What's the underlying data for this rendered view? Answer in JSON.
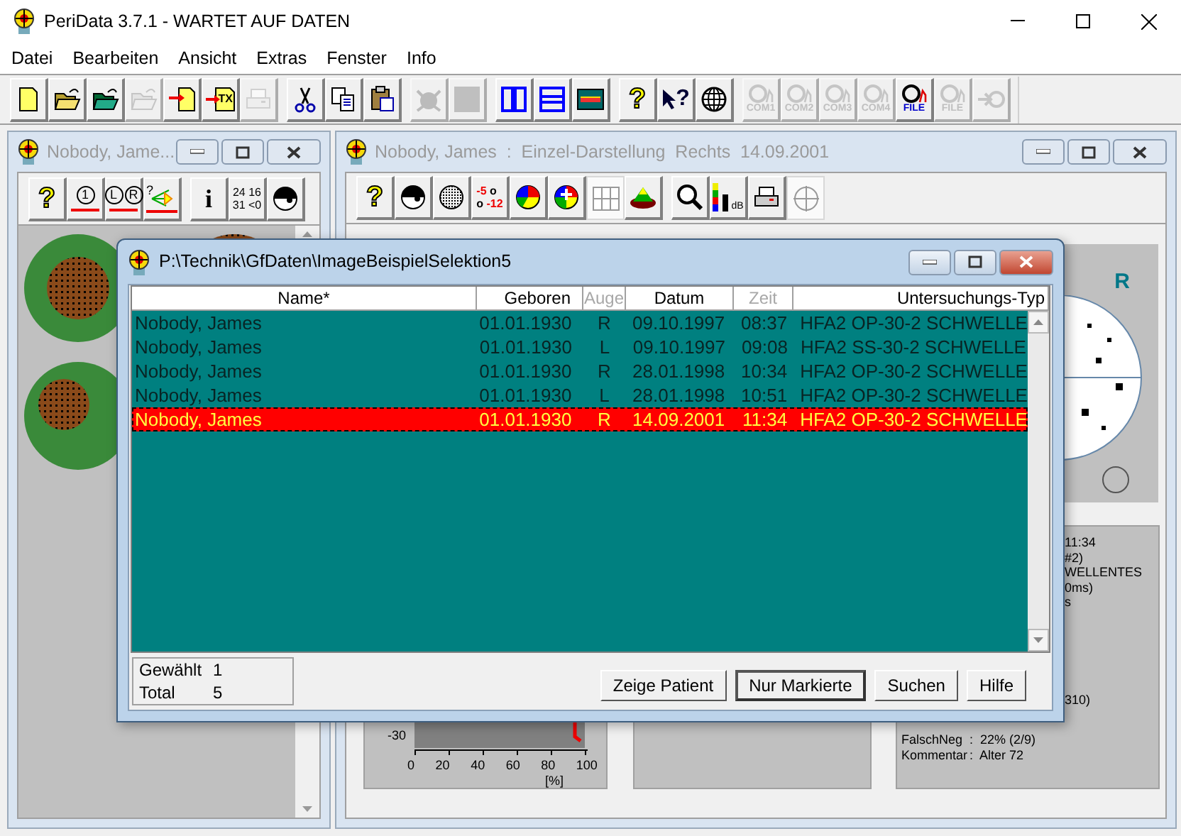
{
  "window": {
    "title": "PeriData 3.7.1 - WARTET AUF DATEN"
  },
  "menu": [
    "Datei",
    "Bearbeiten",
    "Ansicht",
    "Extras",
    "Fenster",
    "Info"
  ],
  "toolbar": [
    {
      "kind": "button",
      "disabled": false
    },
    {
      "kind": "button",
      "disabled": false
    },
    {
      "kind": "button",
      "disabled": false
    },
    {
      "kind": "button",
      "disabled": true
    },
    {
      "kind": "button",
      "disabled": false
    },
    {
      "kind": "button",
      "labels": [
        "TX"
      ],
      "disabled": false
    },
    {
      "kind": "button",
      "disabled": true
    },
    {
      "kind": "separator"
    },
    {
      "kind": "button",
      "disabled": false
    },
    {
      "kind": "button",
      "disabled": false
    },
    {
      "kind": "button",
      "disabled": false
    },
    {
      "kind": "separator"
    },
    {
      "kind": "button",
      "disabled": true
    },
    {
      "kind": "button",
      "disabled": true
    },
    {
      "kind": "separator"
    },
    {
      "kind": "button",
      "disabled": false
    },
    {
      "kind": "button",
      "disabled": false
    },
    {
      "kind": "button",
      "disabled": false
    },
    {
      "kind": "separator"
    },
    {
      "kind": "button",
      "labels": [
        "?"
      ],
      "disabled": false
    },
    {
      "kind": "button",
      "labels": [
        "?"
      ],
      "disabled": false
    },
    {
      "kind": "button",
      "disabled": false
    },
    {
      "kind": "separator"
    },
    {
      "kind": "button",
      "labels": [
        "COM1"
      ],
      "disabled": true
    },
    {
      "kind": "button",
      "labels": [
        "COM2"
      ],
      "disabled": true
    },
    {
      "kind": "button",
      "labels": [
        "COM3"
      ],
      "disabled": true
    },
    {
      "kind": "button",
      "labels": [
        "COM4"
      ],
      "disabled": true
    },
    {
      "kind": "button",
      "labels": [
        "FILE"
      ],
      "disabled": false
    },
    {
      "kind": "button",
      "labels": [
        "FILE"
      ],
      "disabled": true
    },
    {
      "kind": "button",
      "disabled": true
    }
  ],
  "left_window": {
    "title": "Nobody, Jame...",
    "toolbar": [
      {
        "kind": "button",
        "labels": [
          "?"
        ],
        "pressed": false
      },
      {
        "kind": "button",
        "labels": [
          "1"
        ],
        "pressed": false
      },
      {
        "kind": "button",
        "labels": [
          "L",
          "R"
        ],
        "pressed": false
      },
      {
        "kind": "button",
        "labels": [
          "?"
        ],
        "pressed": false
      },
      {
        "kind": "separator"
      },
      {
        "kind": "button",
        "labels": [
          "i"
        ],
        "pressed": false
      },
      {
        "kind": "button",
        "labels": [
          "24 16",
          "31 <0"
        ],
        "pressed": false
      },
      {
        "kind": "button",
        "pressed": false
      }
    ]
  },
  "right_window": {
    "title": "Nobody, James  :  Einzel-Darstellung  Rechts  14.09.2001",
    "toolbar": [
      {
        "kind": "button",
        "labels": [
          "?"
        ],
        "pressed": false
      },
      {
        "kind": "button",
        "pressed": false
      },
      {
        "kind": "button",
        "pressed": false
      },
      {
        "kind": "button",
        "labels": [
          "-5",
          "o",
          "o",
          "-12"
        ],
        "pressed": false
      },
      {
        "kind": "button",
        "pressed": false
      },
      {
        "kind": "button",
        "pressed": false
      },
      {
        "kind": "button",
        "pressed": true
      },
      {
        "kind": "button",
        "pressed": false
      },
      {
        "kind": "separator"
      },
      {
        "kind": "button",
        "pressed": false
      },
      {
        "kind": "button",
        "labels": [
          "dB"
        ],
        "pressed": false
      },
      {
        "kind": "button",
        "pressed": false
      },
      {
        "kind": "button",
        "pressed": true
      }
    ],
    "eye_label": "R",
    "chart_axis": {
      "y_tick": "-30",
      "x_ticks": [
        "0",
        "20",
        "40",
        "60",
        "80",
        "100"
      ],
      "x_unit": "[%]"
    },
    "info_fragments": [
      "11:34",
      "#2)",
      "WELLENTES",
      "0ms)",
      "s",
      "310)"
    ],
    "info_rows": [
      {
        "label": "FalschNeg",
        "value": ":  22% (2/9)"
      },
      {
        "label": "Kommentar",
        "value": ":  Alter 72"
      }
    ]
  },
  "dialog": {
    "title": "P:\\Technik\\GfDaten\\ImageBeispielSelektion5",
    "columns": [
      {
        "label": "Name*",
        "disabled": false
      },
      {
        "label": "Geboren",
        "disabled": false
      },
      {
        "label": "Auge",
        "disabled": true
      },
      {
        "label": "Datum",
        "disabled": false
      },
      {
        "label": "Zeit",
        "disabled": true
      },
      {
        "label": "Untersuchungs-Typ",
        "disabled": false
      }
    ],
    "rows": [
      {
        "cells": [
          "Nobody, James",
          "01.01.1930",
          "R",
          "09.10.1997",
          "08:37",
          "HFA2 OP-30-2 SCHWELLE"
        ],
        "selected": false
      },
      {
        "cells": [
          "Nobody, James",
          "01.01.1930",
          "L",
          "09.10.1997",
          "09:08",
          "HFA2 SS-30-2 SCHWELLE"
        ],
        "selected": false
      },
      {
        "cells": [
          "Nobody, James",
          "01.01.1930",
          "R",
          "28.01.1998",
          "10:34",
          "HFA2 OP-30-2 SCHWELLE"
        ],
        "selected": false
      },
      {
        "cells": [
          "Nobody, James",
          "01.01.1930",
          "L",
          "28.01.1998",
          "10:51",
          "HFA2 OP-30-2 SCHWELLE"
        ],
        "selected": false
      },
      {
        "cells": [
          "Nobody, James",
          "01.01.1930",
          "R",
          "14.09.2001",
          "11:34",
          "HFA2 OP-30-2 SCHWELLE"
        ],
        "selected": true
      }
    ],
    "summary": [
      {
        "label": "Gewählt",
        "value": "1"
      },
      {
        "label": "Total",
        "value": "5"
      }
    ],
    "buttons": [
      {
        "label": "Zeige Patient",
        "default": false
      },
      {
        "label": "Nur Markierte",
        "default": true
      },
      {
        "label": "Suchen",
        "default": false
      },
      {
        "label": "Hilfe",
        "default": false
      }
    ]
  }
}
